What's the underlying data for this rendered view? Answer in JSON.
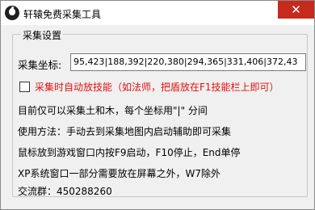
{
  "window": {
    "title": "轩辕免费采集工具",
    "close_glyph": "✕"
  },
  "settings": {
    "group_label": "采集设置",
    "coord_label": "采集坐标:",
    "coord_value": "95,423|188,392|220,380|294,365|331,406|372,43",
    "auto_skill_label": "采集时自动放技能（如法师，把盾放在F1技能栏上即可）",
    "auto_skill_checked": false
  },
  "info": {
    "line1": "目前仅可以采集土和木，每个坐标用\"|\" 分间",
    "line2": "使用方法：手动去到采集地图内启动辅助即可采集",
    "line3": "鼠标放到游戏窗口内按F9启动，F10停止，End单停",
    "line4": "XP系统窗口一部分需要放在屏幕之外，W7除外",
    "line5": "交流群：450288260"
  },
  "colors": {
    "accent_red": "#e01010",
    "close_bg": "#c42b1c"
  }
}
